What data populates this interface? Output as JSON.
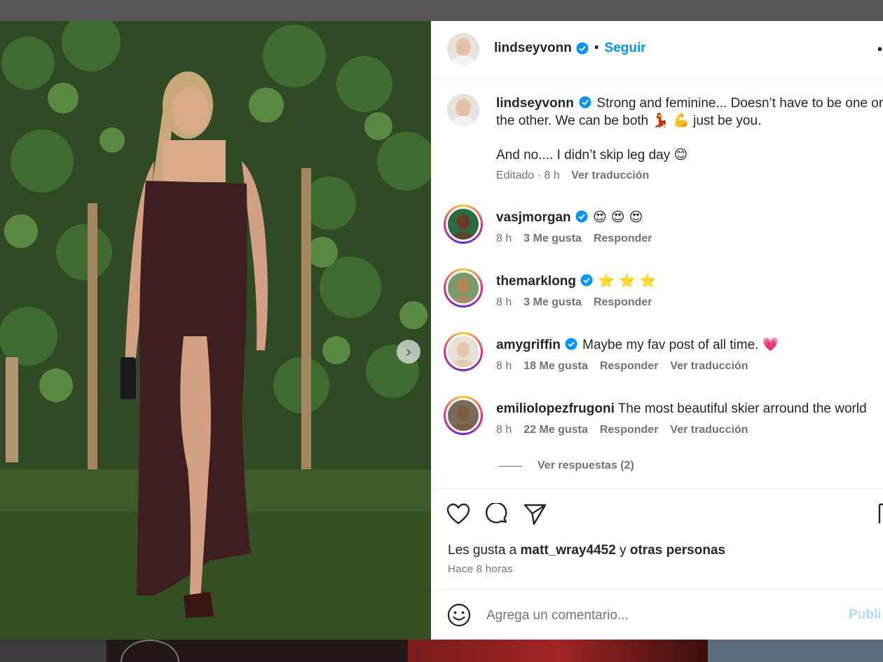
{
  "post": {
    "author": "lindseyvonn",
    "follow_label": "Seguir",
    "more_icon": "more-icon",
    "caption_line1": "Strong and feminine... Doesn’t have to be one or",
    "caption_line2_a": "the other. We can be both",
    "caption_line2_b": "just be you.",
    "caption_emojis": "💃 💪",
    "caption_line3": "And no.... I didn’t skip leg day",
    "caption_line3_emoji": "😊",
    "edited": "Editado · 8 h",
    "see_translation": "Ver traducción"
  },
  "comments": [
    {
      "user": "vasjmorgan",
      "verified": true,
      "text": "",
      "emoji": "😍 😍 😍",
      "time": "8 h",
      "likes": "3 Me gusta",
      "reply": "Responder",
      "translate": ""
    },
    {
      "user": "themarklong",
      "verified": true,
      "text": "",
      "emoji": "⭐ ⭐ ⭐",
      "time": "8 h",
      "likes": "3 Me gusta",
      "reply": "Responder",
      "translate": ""
    },
    {
      "user": "amygriffin",
      "verified": true,
      "text": "Maybe my fav post of all time.",
      "emoji": "💗",
      "time": "8 h",
      "likes": "18 Me gusta",
      "reply": "Responder",
      "translate": "Ver traducción"
    },
    {
      "user": "emiliolopezfrugoni",
      "verified": false,
      "text": "The most beautiful skier arround the world",
      "emoji": "",
      "time": "8 h",
      "likes": "22 Me gusta",
      "reply": "Responder",
      "translate": "Ver traducción"
    }
  ],
  "view_replies": "Ver respuestas (2)",
  "likes": {
    "prefix": "Les gusta a",
    "user": "matt_wray4452",
    "middle": "y",
    "others": "otras personas",
    "time": "Hace 8 horas"
  },
  "add_comment": {
    "placeholder": "Agrega un comentario...",
    "publish": "Publi"
  },
  "carousel": {
    "count": 7,
    "active": 0
  },
  "colors": {
    "accent": "#0095f6",
    "verified": "#0095f6"
  }
}
